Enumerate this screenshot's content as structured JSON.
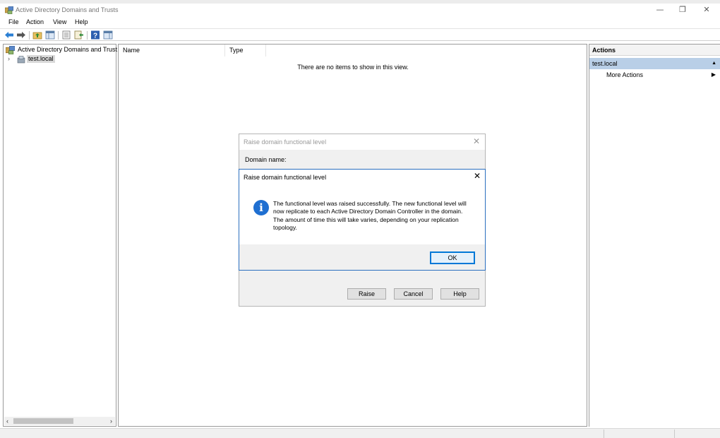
{
  "window": {
    "title": "Active Directory Domains and Trusts",
    "minimize_glyph": "—",
    "restore_glyph": "❐",
    "close_glyph": "✕"
  },
  "menu": [
    "File",
    "Action",
    "View",
    "Help"
  ],
  "toolbar": {
    "icons": [
      "back-arrow-icon",
      "forward-arrow-icon",
      "up-folder-icon",
      "show-hide-tree-icon",
      "properties-icon",
      "export-list-icon",
      "help-icon",
      "show-hide-action-pane-icon"
    ]
  },
  "tree": {
    "root_label": "Active Directory Domains and Trust",
    "expander_glyph": "›",
    "child_label": "test.local",
    "scroll_left": "‹",
    "scroll_right": "›"
  },
  "list": {
    "columns": [
      "Name",
      "Type"
    ],
    "empty_message": "There are no items to show in this view."
  },
  "actions": {
    "header": "Actions",
    "context_label": "test.local",
    "collapse_glyph": "▲",
    "more_actions": "More Actions",
    "more_arrow": "▶"
  },
  "dialog_back": {
    "title": "Raise domain functional level",
    "close_glyph": "✕",
    "domain_name_label": "Domain name:",
    "buttons": {
      "raise": "Raise",
      "cancel": "Cancel",
      "help": "Help"
    }
  },
  "dialog_front": {
    "title": "Raise domain functional level",
    "close_glyph": "✕",
    "icon": "i",
    "message": "The functional level was raised successfully. The new functional level will now replicate to each Active Directory Domain Controller in the domain. The amount of time this will take varies, depending on your replication topology.",
    "ok_label": "OK"
  },
  "colors": {
    "selection": "#b9cfe7",
    "info_blue": "#1f6fd1",
    "focus_border": "#0078d7"
  }
}
